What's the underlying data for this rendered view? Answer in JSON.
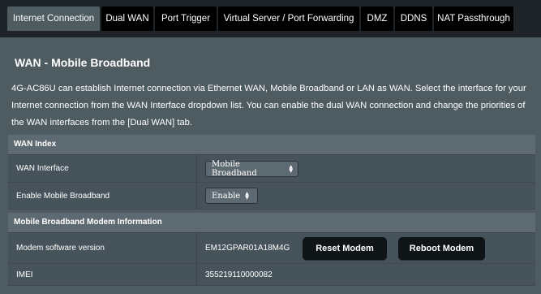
{
  "tabs": {
    "internet": "Internet Connection",
    "dualwan": "Dual WAN",
    "porttrigger": "Port Trigger",
    "virtualserver": "Virtual Server / Port Forwarding",
    "dmz": "DMZ",
    "ddns": "DDNS",
    "nat": "NAT Passthrough",
    "active": "Internet Connection"
  },
  "page": {
    "title": "WAN - Mobile Broadband",
    "description": "4G-AC86U can establish Internet connection via Ethernet WAN, Mobile Broadband or LAN as WAN. Select the interface for your Internet connection from the WAN Interface dropdown list. You can enable the dual WAN connection and change the priorities of the WAN interfaces from the [Dual WAN] tab."
  },
  "wan_index": {
    "header": "WAN Index",
    "wan_interface_label": "WAN Interface",
    "wan_interface_value": "Mobile Broadband",
    "enable_label": "Enable Mobile Broadband",
    "enable_value": "Enable"
  },
  "modem_info": {
    "header": "Mobile Broadband Modem Information",
    "software_label": "Modem software version",
    "software_value": "EM12GPAR01A18M4G",
    "reset_button": "Reset Modem",
    "reboot_button": "Reboot Modem",
    "imei_label": "IMEI",
    "imei_value": "355219110000082"
  },
  "icons": {
    "select_arrows": "updown-arrows-icon"
  },
  "colors": {
    "background": "#4e5b60",
    "tab_bar": "#1e2428",
    "tab_inactive": "#000000",
    "button": "#0f1416",
    "section_header": "#5e6a71"
  }
}
